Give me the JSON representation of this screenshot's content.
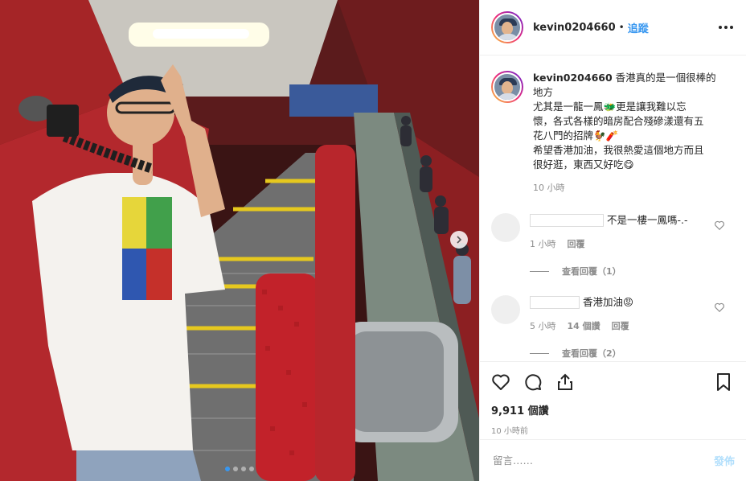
{
  "post": {
    "username": "kevin0204660",
    "separator": "•",
    "follow_label": "追蹤",
    "caption_lines": [
      "香港真的是一個很棒的",
      "地方",
      "尤其是一龍一鳳🐲更是讓我難以忘",
      "懷，各式各樣的暗房配合殘磣漾還有五",
      "花八門的招牌🐓🧨",
      "希望香港加油，我很熱愛這個地方而且",
      "很好逛，東西又好吃😋"
    ],
    "caption_time": "10 小時"
  },
  "comments": [
    {
      "text": "不是一樓一鳳嗎-.-",
      "time": "1 小時",
      "likes": "",
      "reply_label": "回覆",
      "view_replies": "查看回覆（1）"
    },
    {
      "text": "香港加油😡",
      "time": "5 小時",
      "likes": "14 個讚",
      "reply_label": "回覆",
      "view_replies": "查看回覆（2）"
    }
  ],
  "actions": {
    "views": "9,911 個讚",
    "posted": "10 小時前"
  },
  "comment_box": {
    "placeholder": "留言……",
    "post_label": "發佈"
  },
  "carousel": {
    "dots": 4,
    "active_index": 0
  },
  "colors": {
    "accent": "#3897f0",
    "photo_red": "#b3282d",
    "muted": "#8e8e8e"
  }
}
